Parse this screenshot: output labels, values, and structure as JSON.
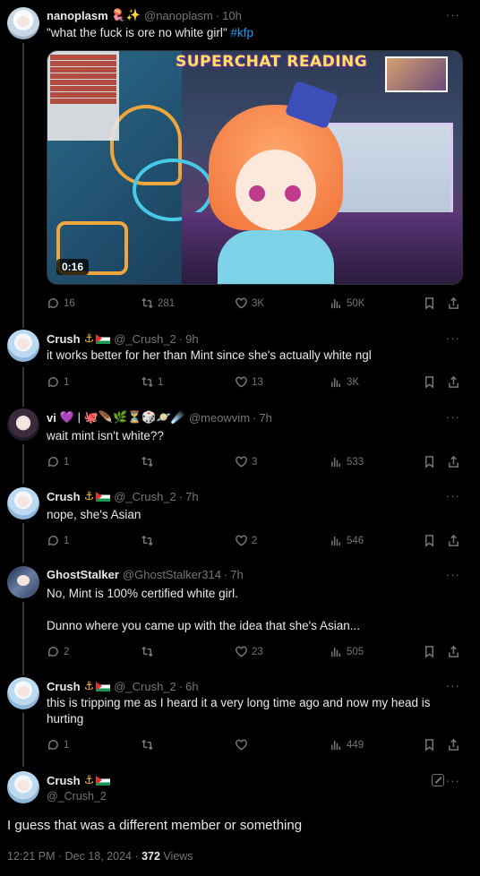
{
  "tweets": [
    {
      "name": "nanoplasm",
      "badges": "🪼✨",
      "handle": "@nanoplasm",
      "time": "10h",
      "text": "\"what the fuck is ore no white girl\" ",
      "hashtag": "#kfp",
      "media": {
        "banner": "SUPERCHAT READING",
        "duration": "0:16"
      },
      "stats": {
        "replies": "16",
        "reposts": "281",
        "likes": "3K",
        "views": "50K"
      }
    },
    {
      "name": "Crush",
      "handle": "@_Crush_2",
      "time": "9h",
      "text": "it works better for her than Mint since she's actually white ngl",
      "stats": {
        "replies": "1",
        "reposts": "1",
        "likes": "13",
        "views": "3K"
      }
    },
    {
      "name": "vi",
      "badges": "💜 | 🐙🪶🌿⏳🎲🪐☄️",
      "handle": "@meowvim",
      "time": "7h",
      "text": "wait mint isn't white??",
      "stats": {
        "replies": "1",
        "reposts": "",
        "likes": "3",
        "views": "533"
      }
    },
    {
      "name": "Crush",
      "handle": "@_Crush_2",
      "time": "7h",
      "text": "nope, she's Asian",
      "stats": {
        "replies": "1",
        "reposts": "",
        "likes": "2",
        "views": "546"
      }
    },
    {
      "name": "GhostStalker",
      "handle": "@GhostStalker314",
      "time": "7h",
      "text_line1": "No, Mint is 100% certified white girl.",
      "text_line2": "Dunno where you came up with the idea that she's Asian...",
      "stats": {
        "replies": "2",
        "reposts": "",
        "likes": "23",
        "views": "505"
      }
    },
    {
      "name": "Crush",
      "handle": "@_Crush_2",
      "time": "6h",
      "text_line1": "this is tripping me as I heard it a very long time ago and now my head is",
      "text_line2": "hurting",
      "stats": {
        "replies": "1",
        "reposts": "",
        "likes": "",
        "views": "449"
      }
    }
  ],
  "main": {
    "name": "Crush",
    "handle": "@_Crush_2",
    "text": "I guess that was a different member or something",
    "timestamp": "12:21 PM · Dec 18, 2024 · ",
    "views_count": "372",
    "views_label": " Views"
  },
  "separator": "·",
  "more": "···"
}
